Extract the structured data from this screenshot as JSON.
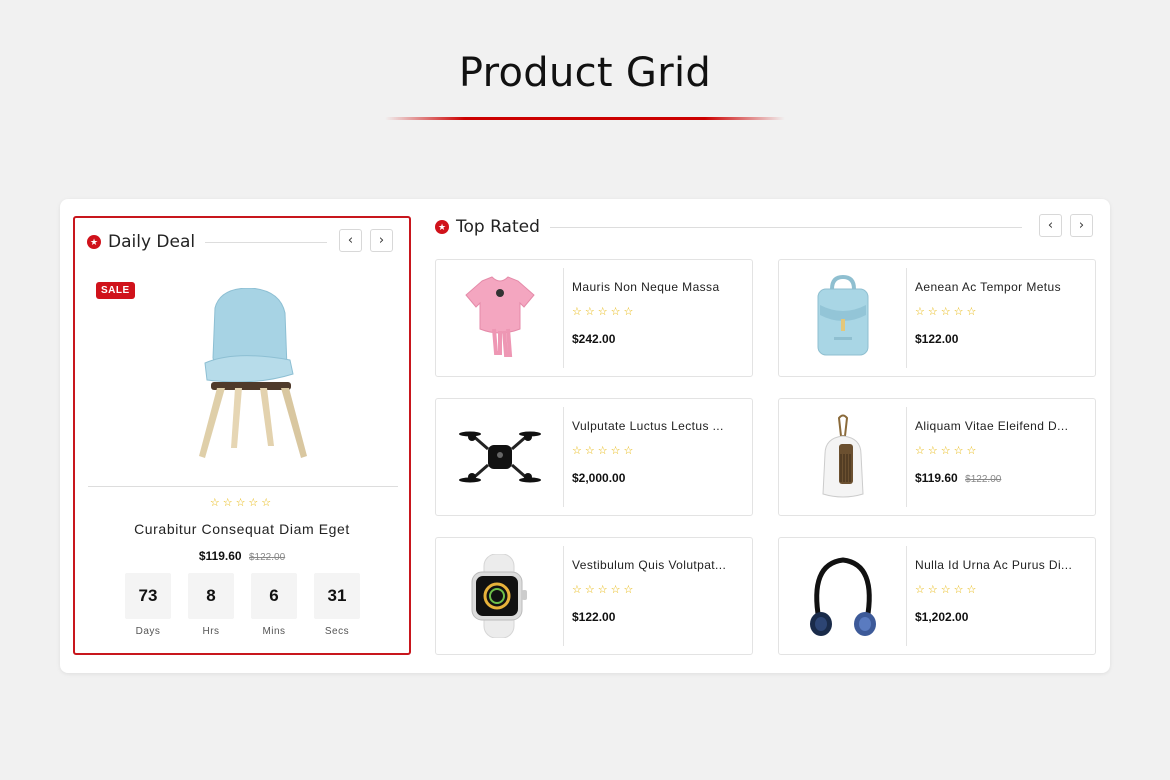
{
  "heading": "Product Grid",
  "colors": {
    "accent": "#d0121b",
    "star": "#e6b400",
    "background": "#f1f1f1"
  },
  "daily_deal": {
    "title": "Daily Deal",
    "prev_icon": "chevron-left-icon",
    "next_icon": "chevron-right-icon",
    "sale_badge": "SALE",
    "stars": "☆☆☆☆☆",
    "product_name": "Curabitur Consequat Diam Eget",
    "price": "$119.60",
    "old_price": "$122.00",
    "countdown": [
      {
        "value": "73",
        "label": "Days"
      },
      {
        "value": "8",
        "label": "Hrs"
      },
      {
        "value": "6",
        "label": "Mins"
      },
      {
        "value": "31",
        "label": "Secs"
      }
    ]
  },
  "top_rated": {
    "title": "Top Rated",
    "products": [
      {
        "name": "Mauris Non Neque Massa",
        "stars": "☆☆☆☆☆",
        "price": "$242.00",
        "old_price": "",
        "icon": "pink-top-icon"
      },
      {
        "name": "Aenean Ac Tempor Metus",
        "stars": "☆☆☆☆☆",
        "price": "$122.00",
        "old_price": "",
        "icon": "backpack-icon"
      },
      {
        "name": "Vulputate Luctus Lectus ...",
        "stars": "☆☆☆☆☆",
        "price": "$2,000.00",
        "old_price": "",
        "icon": "drone-icon"
      },
      {
        "name": "Aliquam Vitae Eleifend D...",
        "stars": "☆☆☆☆☆",
        "price": "$119.60",
        "old_price": "$122.00",
        "icon": "dustpan-brush-icon"
      },
      {
        "name": "Vestibulum Quis Volutpat...",
        "stars": "☆☆☆☆☆",
        "price": "$122.00",
        "old_price": "",
        "icon": "smartwatch-icon"
      },
      {
        "name": "Nulla Id Urna Ac Purus Di...",
        "stars": "☆☆☆☆☆",
        "price": "$1,202.00",
        "old_price": "",
        "icon": "neckband-speaker-icon"
      }
    ]
  }
}
